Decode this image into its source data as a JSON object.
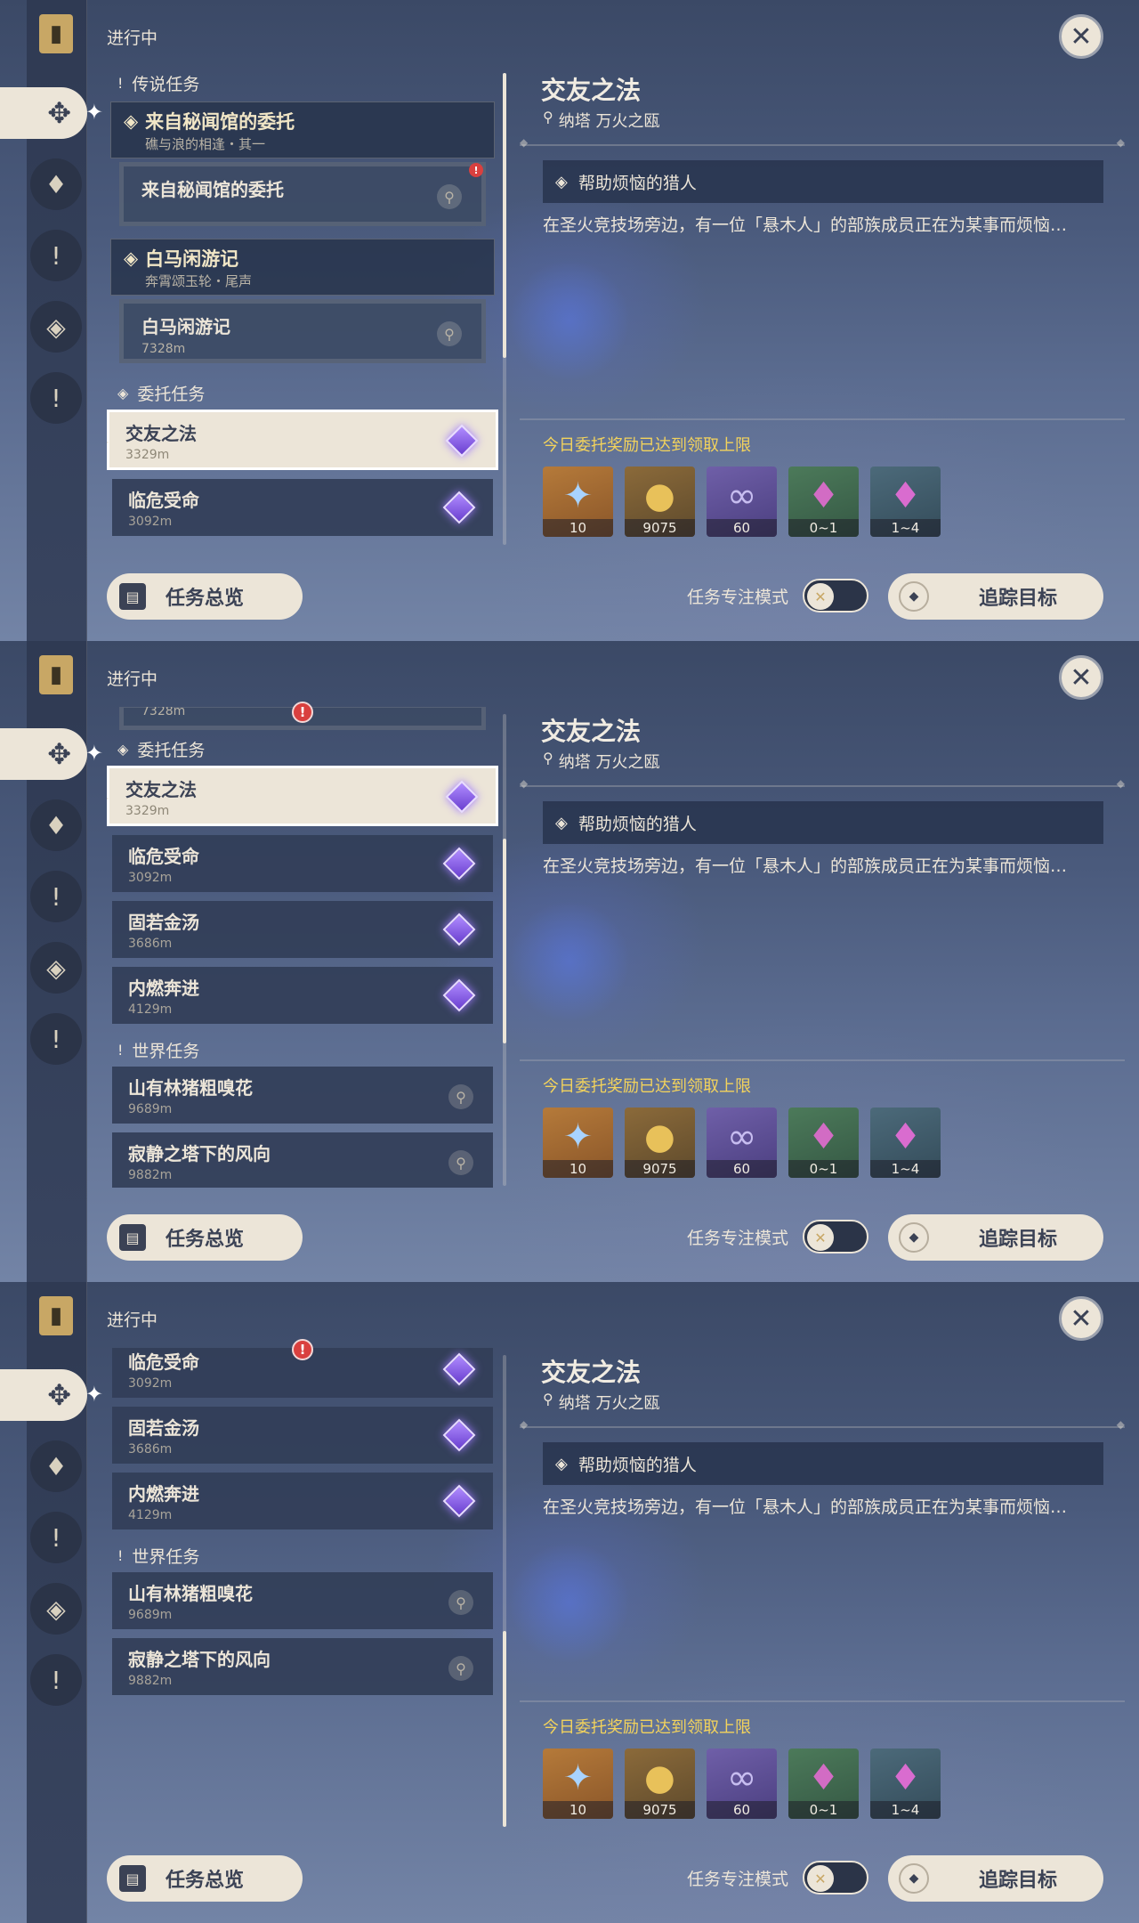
{
  "header": "进行中",
  "sections": {
    "legend": "传说任务",
    "commission": "委托任务",
    "world": "世界任务"
  },
  "legend_quests": [
    {
      "title": "来自秘闻馆的委托",
      "subtitle": "礁与浪的相逢・其一",
      "sub_title": "来自秘闻馆的委托",
      "sub_dist": ""
    },
    {
      "title": "白马闲游记",
      "subtitle": "奔霄颂玉轮・尾声",
      "sub_title": "白马闲游记",
      "sub_dist": "7328m"
    }
  ],
  "commissions": [
    {
      "title": "交友之法",
      "dist": "3329m"
    },
    {
      "title": "临危受命",
      "dist": "3092m"
    },
    {
      "title": "固若金汤",
      "dist": "3686m"
    },
    {
      "title": "内燃奔进",
      "dist": "4129m"
    }
  ],
  "world_quests": [
    {
      "title": "山有林猪粗嗅花",
      "dist": "9689m"
    },
    {
      "title": "寂静之塔下的风向",
      "dist": "9882m"
    }
  ],
  "detail": {
    "title": "交友之法",
    "location": "纳塔 万火之瓯",
    "objective": "帮助烦恼的猎人",
    "description": "在圣火竞技场旁边，有一位「悬木人」的部族成员正在为某事而烦恼…",
    "reward_label": "今日委托奖励已达到领取上限",
    "rewards": [
      {
        "icon": "primogem-icon",
        "count": "10"
      },
      {
        "icon": "mora-icon",
        "count": "9075"
      },
      {
        "icon": "companionship-icon",
        "count": "60"
      },
      {
        "icon": "crystal-icon",
        "count": "0~1"
      },
      {
        "icon": "crystal-chunk-icon",
        "count": "1~4"
      }
    ]
  },
  "buttons": {
    "overview": "任务总览",
    "focus_mode": "任务专注模式",
    "track": "追踪目标"
  }
}
